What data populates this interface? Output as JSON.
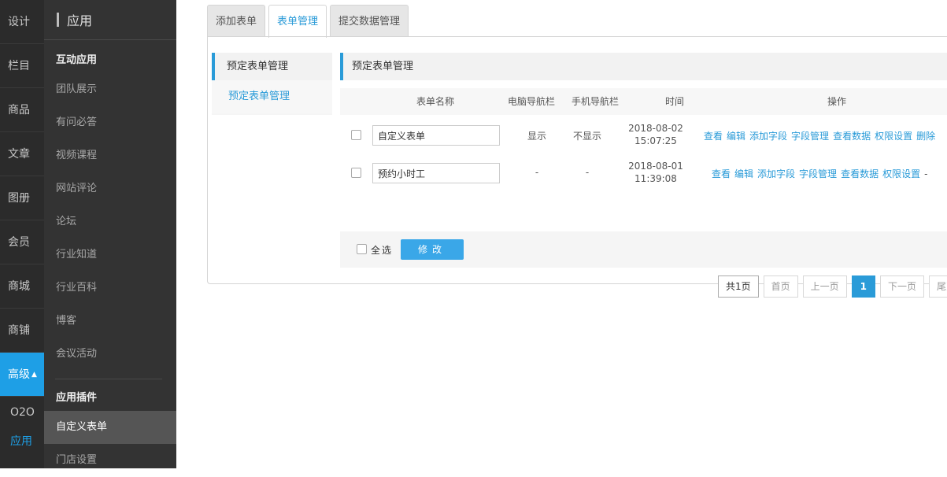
{
  "nav1": {
    "items": [
      "设计",
      "栏目",
      "商品",
      "文章",
      "图册",
      "会员",
      "商城",
      "商铺"
    ],
    "active": "高级",
    "sub_items": [
      "O2O",
      "应用"
    ]
  },
  "nav2": {
    "title": "应用",
    "group1": "互动应用",
    "items": [
      "团队展示",
      "有问必答",
      "视频课程",
      "网站评论",
      "论坛",
      "行业知道",
      "行业百科",
      "博客",
      "会议活动"
    ],
    "group2": "应用插件",
    "plugin_items": [
      "自定义表单",
      "门店设置"
    ]
  },
  "tabs": [
    "添加表单",
    "表单管理",
    "提交数据管理"
  ],
  "left": {
    "header": "预定表单管理",
    "link": "预定表单管理"
  },
  "right": {
    "header": "预定表单管理",
    "columns": {
      "name": "表单名称",
      "pc_nav": "电脑导航栏",
      "mobile_nav": "手机导航栏",
      "time": "时间",
      "ops": "操作"
    },
    "rows": [
      {
        "name": "自定义表单",
        "pc_nav": "显示",
        "mobile_nav": "不显示",
        "date": "2018-08-02",
        "time": "15:07:25",
        "ops": [
          "查看",
          "编辑",
          "添加字段",
          "字段管理",
          "查看数据",
          "权限设置",
          "删除"
        ]
      },
      {
        "name": "预约小时工",
        "pc_nav": "-",
        "mobile_nav": "-",
        "date": "2018-08-01",
        "time": "11:39:08",
        "ops": [
          "查看",
          "编辑",
          "添加字段",
          "字段管理",
          "查看数据",
          "权限设置"
        ],
        "trailing": "-"
      }
    ],
    "select_all": "全选",
    "edit_button": "修改"
  },
  "pager": {
    "info": "共1页",
    "first": "首页",
    "prev": "上一页",
    "current": "1",
    "next": "下一页",
    "last": "尾页"
  },
  "colors": {
    "accent": "#2a9bd8",
    "nav_active": "#1e9fe6",
    "button": "#3aa7e8"
  }
}
